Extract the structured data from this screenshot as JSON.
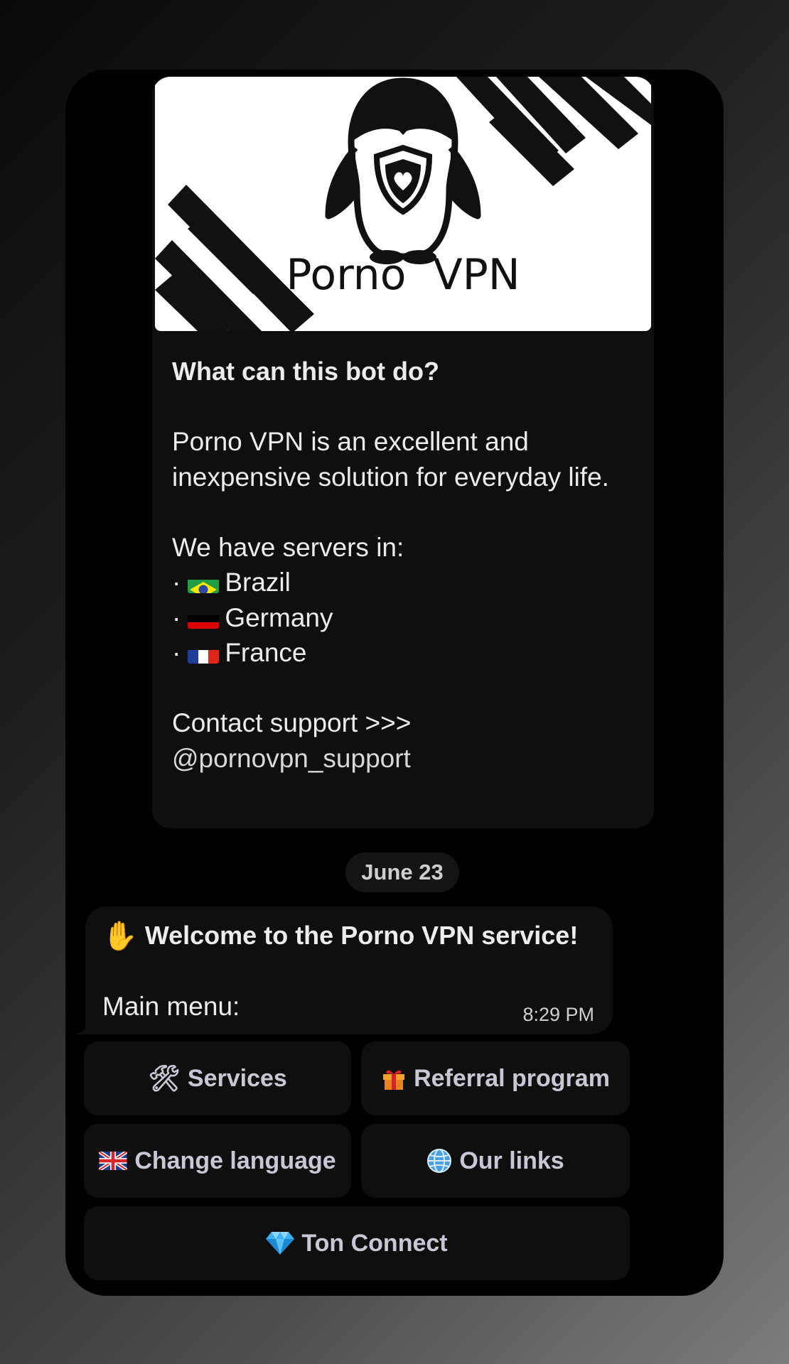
{
  "banner": {
    "brand_word1": "Porno",
    "brand_word2": "VPN"
  },
  "description": {
    "heading": "What can this bot do?",
    "intro": "Porno VPN is an excellent and inexpensive solution for everyday life.",
    "servers_label": "We have servers in:",
    "servers": [
      {
        "bullet": "·",
        "flag": "brazil-flag-icon",
        "name": "Brazil"
      },
      {
        "bullet": "·",
        "flag": "germany-flag-icon",
        "name": "Germany"
      },
      {
        "bullet": "·",
        "flag": "france-flag-icon",
        "name": "France"
      }
    ],
    "contact_label": "Contact support >>>",
    "contact_handle": "@pornovpn_support"
  },
  "date_chip": "June 23",
  "welcome_message": {
    "icon": "raised-hand-icon",
    "title": "Welcome to the Porno VPN service!",
    "body": "Main menu:",
    "time": "8:29 PM"
  },
  "keyboard": {
    "services": {
      "icon": "hammer-wrench-icon",
      "label": "Services"
    },
    "referral": {
      "icon": "gift-icon",
      "label": "Referral program"
    },
    "language": {
      "icon": "uk-flag-icon",
      "label": "Change language"
    },
    "links": {
      "icon": "globe-icon",
      "label": "Our links"
    },
    "ton": {
      "icon": "gem-icon",
      "label": "Ton Connect"
    }
  },
  "colors": {
    "bubble": "#0f0f0f",
    "text": "#ececec",
    "button_text": "#c8c8d4"
  }
}
